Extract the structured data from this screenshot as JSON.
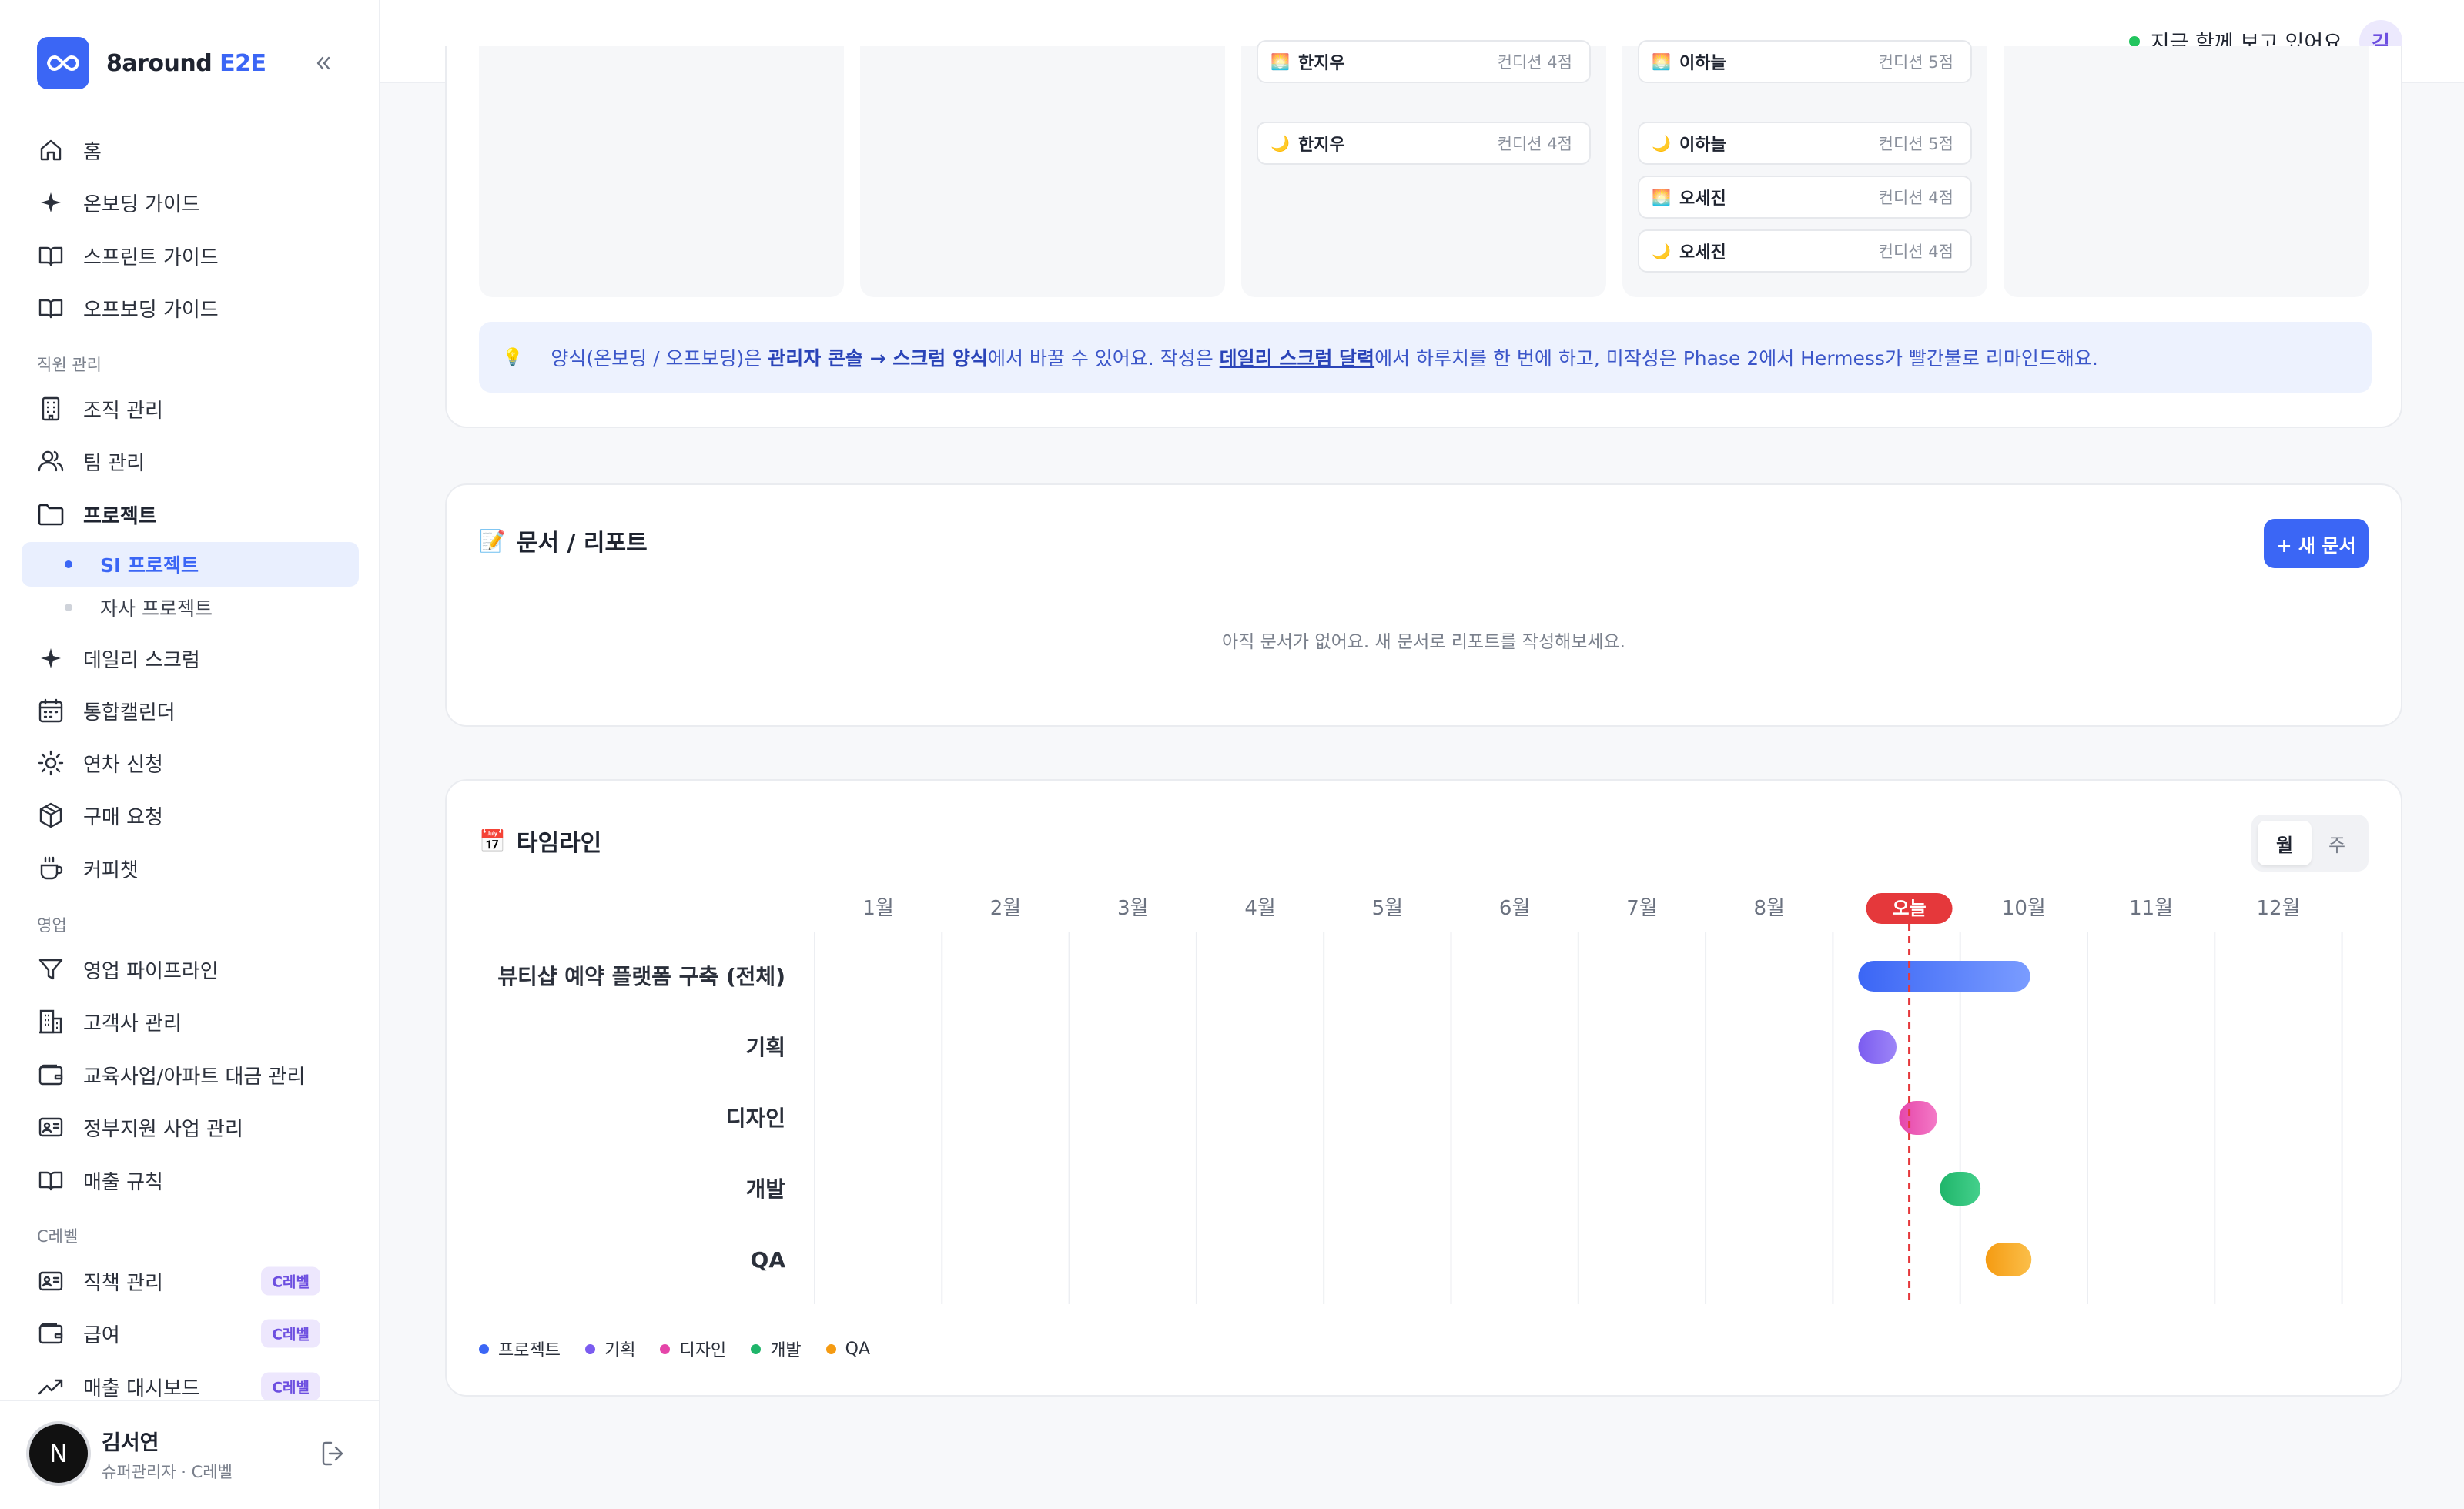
{
  "brand": {
    "name_main": "8around",
    "name_accent": "E2E"
  },
  "nav": {
    "home": "홈",
    "onboarding": "온보딩 가이드",
    "sprint": "스프린트 가이드",
    "offboarding": "오프보딩 가이드",
    "section_staff": "직원 관리",
    "org": "조직 관리",
    "team": "팀 관리",
    "project": "프로젝트",
    "si_project": "SI 프로젝트",
    "own_project": "자사 프로젝트",
    "scrum": "데일리 스크럼",
    "calendar": "통합캘린더",
    "leave": "연차 신청",
    "purchase": "구매 요청",
    "coffee": "커피챗",
    "section_sales": "영업",
    "pipeline": "영업 파이프라인",
    "clients": "고객사 관리",
    "edu": "교육사업/아파트 대금 관리",
    "gov": "정부지원 사업 관리",
    "rules": "매출 규칙",
    "section_c": "C레벨",
    "duties": "직책 관리",
    "salary": "급여",
    "dashboard": "매출 대시보드",
    "c_badge": "C레벨"
  },
  "user": {
    "name": "김서연",
    "role": "슈퍼관리자 · C레벨",
    "initial": "N"
  },
  "topbar": {
    "presence": "지금 함께 보고 있어요",
    "avatar": "김"
  },
  "scrum_rows": [
    {
      "icon": "🌅",
      "name": "한지우",
      "cond": "컨디션 4점"
    },
    {
      "icon": "🌙",
      "name": "한지우",
      "cond": "컨디션 4점"
    },
    {
      "icon": "🌅",
      "name": "이하늘",
      "cond": "컨디션 5점"
    },
    {
      "icon": "🌙",
      "name": "이하늘",
      "cond": "컨디션 5점"
    },
    {
      "icon": "🌅",
      "name": "오세진",
      "cond": "컨디션 4점"
    },
    {
      "icon": "🌙",
      "name": "오세진",
      "cond": "컨디션 4점"
    }
  ],
  "tip": {
    "icon": "💡",
    "p1": "양식(온보딩 / 오프보딩)은 ",
    "b1": "관리자 콘솔 → 스크럼 양식",
    "p2": "에서 바꿀 수 있어요. 작성은 ",
    "u1": "데일리 스크럼 달력",
    "p3": "에서 하루치를 한 번에 하고, 미작성은 Phase 2에서 Hermess가 빨간불로 리마인드해요."
  },
  "docs": {
    "icon": "📝",
    "title": "문서 / 리포트",
    "new_btn": "+ 새 문서",
    "empty": "아직 문서가 없어요. 새 문서로 리포트를 작성해보세요."
  },
  "timeline": {
    "icon": "📅",
    "title": "타임라인",
    "view_month": "월",
    "view_week": "주",
    "months": [
      "1월",
      "2월",
      "3월",
      "4월",
      "5월",
      "6월",
      "7월",
      "8월",
      "9월",
      "10월",
      "11월",
      "12월"
    ],
    "today_label": "오늘",
    "today_month_pos": 8.6,
    "rows": [
      {
        "label": "뷰티샵 예약 플랫폼 구축 (전체)",
        "start": 8.2,
        "end": 9.55,
        "color_from": "#3b66f5",
        "color_to": "#7a9cff"
      },
      {
        "label": "기획",
        "start": 8.2,
        "end": 8.5,
        "color_from": "#7b5cf0",
        "color_to": "#9d85f7"
      },
      {
        "label": "디자인",
        "start": 8.52,
        "end": 8.82,
        "color_from": "#e545a9",
        "color_to": "#f47ac7"
      },
      {
        "label": "개발",
        "start": 8.84,
        "end": 9.16,
        "color_from": "#1fb56a",
        "color_to": "#45d08c"
      },
      {
        "label": "QA",
        "start": 9.2,
        "end": 9.56,
        "color_from": "#f59b12",
        "color_to": "#fbbf4a"
      }
    ],
    "legend": [
      {
        "label": "프로젝트",
        "color": "#3b66f5"
      },
      {
        "label": "기획",
        "color": "#7b5cf0"
      },
      {
        "label": "디자인",
        "color": "#e545a9"
      },
      {
        "label": "개발",
        "color": "#1fb56a"
      },
      {
        "label": "QA",
        "color": "#f59b12"
      }
    ]
  }
}
